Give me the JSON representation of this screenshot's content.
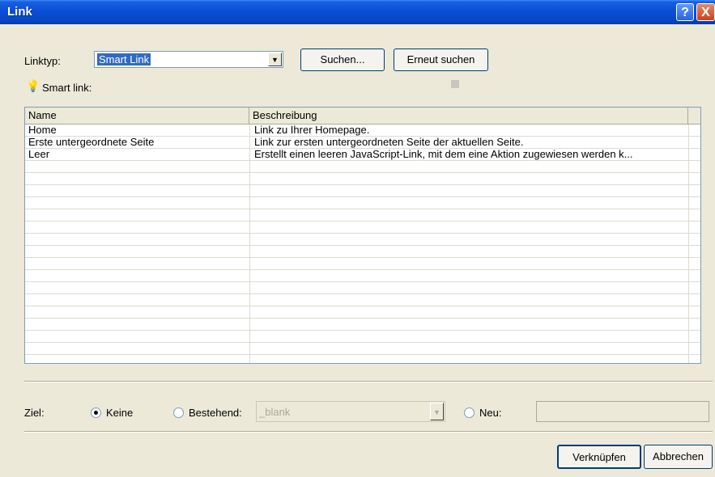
{
  "window": {
    "title": "Link"
  },
  "titlebar": {
    "help_label": "?",
    "close_label": "X"
  },
  "linktyp": {
    "label": "Linktyp:",
    "value": "Smart Link"
  },
  "buttons": {
    "suchen": "Suchen...",
    "erneut_suchen": "Erneut suchen",
    "verknuepfen": "Verknüpfen",
    "abbrechen": "Abbrechen"
  },
  "smart_link": {
    "label": "Smart link:"
  },
  "table": {
    "headers": [
      "Name",
      "Beschreibung"
    ],
    "rows": [
      {
        "name": "Home",
        "desc": "Link zu Ihrer Homepage."
      },
      {
        "name": "Erste untergeordnete Seite",
        "desc": "Link zur ersten untergeordneten Seite der aktuellen Seite."
      },
      {
        "name": "Leer",
        "desc": "Erstellt einen leeren JavaScript-Link, mit dem eine Aktion zugewiesen werden k..."
      }
    ]
  },
  "target": {
    "label": "Ziel:",
    "keine_label": "Keine",
    "bestehend_label": "Bestehend:",
    "bestehend_value": "_blank",
    "neu_label": "Neu:",
    "neu_value": "",
    "selected": "Keine"
  }
}
